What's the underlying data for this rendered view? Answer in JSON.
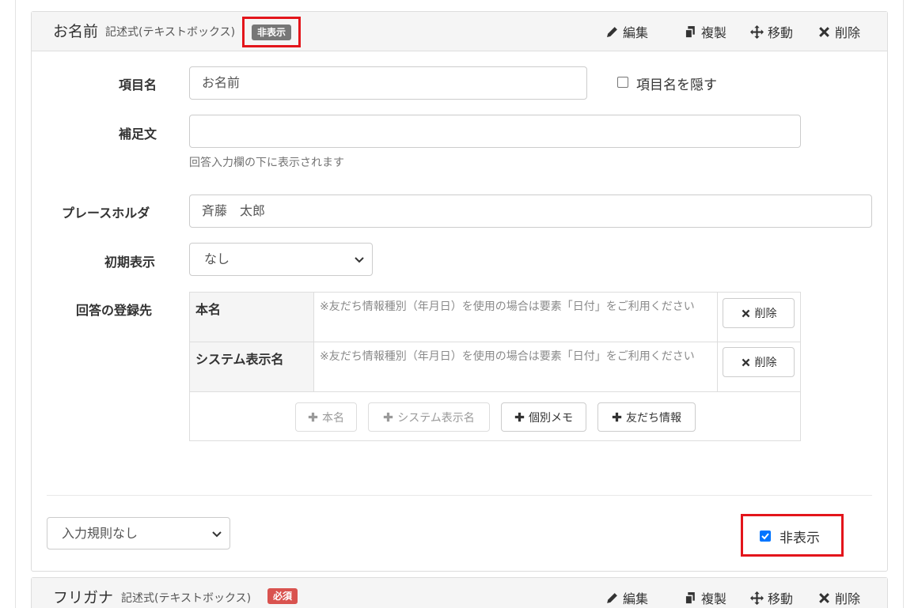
{
  "card1": {
    "title": "お名前",
    "type_label": "記述式(テキストボックス)",
    "badge": "非表示",
    "actions": {
      "edit": "編集",
      "duplicate": "複製",
      "move": "移動",
      "delete": "削除"
    },
    "form": {
      "item_name_label": "項目名",
      "item_name_value": "お名前",
      "hide_item_name_label": "項目名を隠す",
      "supplement_label": "補足文",
      "supplement_value": "",
      "supplement_help": "回答入力欄の下に表示されます",
      "placeholder_label": "プレースホルダ",
      "placeholder_value": "斉藤　太郎",
      "initial_display_label": "初期表示",
      "initial_display_value": "なし",
      "registration_label": "回答の登録先"
    },
    "registration": {
      "rows": [
        {
          "name": "本名",
          "note": "※友だち情報種別（年月日）を使用の場合は要素「日付」をご利用ください",
          "delete_label": "削除"
        },
        {
          "name": "システム表示名",
          "note": "※友だち情報種別（年月日）を使用の場合は要素「日付」をご利用ください",
          "delete_label": "削除"
        }
      ],
      "add_buttons": {
        "real_name": "本名",
        "system_name": "システム表示名",
        "memo": "個別メモ",
        "friend_info": "友だち情報"
      }
    },
    "footer": {
      "validation_value": "入力規則なし",
      "hidden_label": "非表示",
      "hidden_checked": true
    }
  },
  "card2": {
    "title": "フリガナ",
    "type_label": "記述式(テキストボックス)",
    "badge": "必須",
    "actions": {
      "edit": "編集",
      "duplicate": "複製",
      "move": "移動",
      "delete": "削除"
    }
  },
  "colors": {
    "highlight": "#e3151b",
    "badge_hidden": "#777777",
    "badge_required": "#d9534f",
    "checkbox": "#0075ff"
  }
}
